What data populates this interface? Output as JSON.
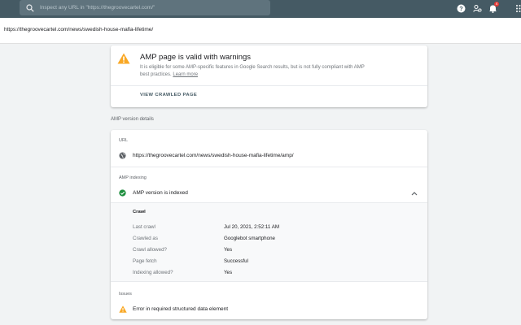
{
  "header": {
    "search_placeholder": "Inspect any URL in \"https://thegroovecartel.com/\"",
    "notification_count": "4"
  },
  "inspected_url": "https://thegroovecartel.com/news/swedish-house-mafia-lifetime/",
  "status": {
    "title": "AMP page is valid with warnings",
    "description": "It is eligible for some AMP-specific features in Google Search results, but is not fully compliant with AMP best practices.",
    "learn_more": "Learn more",
    "view_crawled_label": "VIEW CRAWLED PAGE"
  },
  "amp_details": {
    "section_label": "AMP version details",
    "url_label": "URL",
    "amp_url": "https://thegroovecartel.com/news/swedish-house-mafia-lifetime/amp/",
    "indexing_label": "AMP indexing",
    "indexing_status": "AMP version is indexed",
    "crawl": {
      "title": "Crawl",
      "rows": [
        {
          "key": "Last crawl",
          "value": "Jul 20, 2021, 2:52:11 AM"
        },
        {
          "key": "Crawled as",
          "value": "Googlebot smartphone"
        },
        {
          "key": "Crawl allowed?",
          "value": "Yes"
        },
        {
          "key": "Page fetch",
          "value": "Successful"
        },
        {
          "key": "Indexing allowed?",
          "value": "Yes"
        }
      ]
    },
    "issues_label": "Issues",
    "issues": [
      {
        "text": "Error in required structured data element"
      }
    ]
  },
  "colors": {
    "topbar": "#455a64",
    "warning": "#f9a825",
    "success": "#1e8e3e",
    "notification": "#e53935"
  },
  "icons": {
    "search": "search-icon",
    "help": "help-icon",
    "users": "manage-users-icon",
    "notifications": "bell-icon",
    "apps": "apps-grid-icon",
    "warning": "warning-icon",
    "globe": "globe-icon",
    "check": "check-circle-icon",
    "chevron": "chevron-up-icon"
  }
}
